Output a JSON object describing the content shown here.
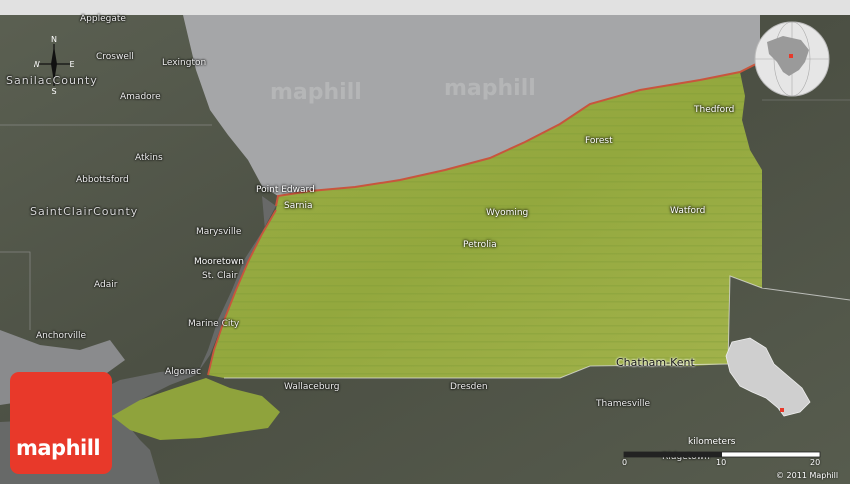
{
  "map": {
    "watermarks": [
      "maphill",
      "maphill"
    ],
    "places": {
      "applegate": "Applegate",
      "croswell": "Croswell",
      "lexington": "Lexington",
      "sanilac_county": "SanilacCounty",
      "amadore": "Amadore",
      "atkins": "Atkins",
      "abbottsford": "Abbottsford",
      "saint_clair_county": "SaintClairCounty",
      "point_edward": "Point Edward",
      "sarnia": "Sarnia",
      "marysville": "Marysville",
      "mooretown": "Mooretown",
      "st_clair": "St. Clair",
      "adair": "Adair",
      "marine_city": "Marine City",
      "anchorville": "Anchorville",
      "algonac": "Algonac",
      "wallaceburg": "Wallaceburg",
      "dresden": "Dresden",
      "thamesville": "Thamesville",
      "chatham_kent": "Chatham-Kent",
      "forest": "Forest",
      "thedford": "Thedford",
      "wyoming": "Wyoming",
      "watford": "Watford",
      "petrolia": "Petrolia",
      "ridgetown": "Ridgetown"
    },
    "compass": {
      "n": "N",
      "s": "S",
      "e": "E",
      "w": "W"
    },
    "colors": {
      "highlight": "#9cb040",
      "water": "#a6a7a9",
      "land": "#555a4c",
      "border": "#c8553d"
    }
  },
  "logo": {
    "text": "maphill",
    "color": "#e8392a"
  },
  "scale": {
    "title": "kilometers",
    "ticks": [
      "0",
      "10",
      "20"
    ]
  },
  "copyright": "© 2011 Maphill"
}
